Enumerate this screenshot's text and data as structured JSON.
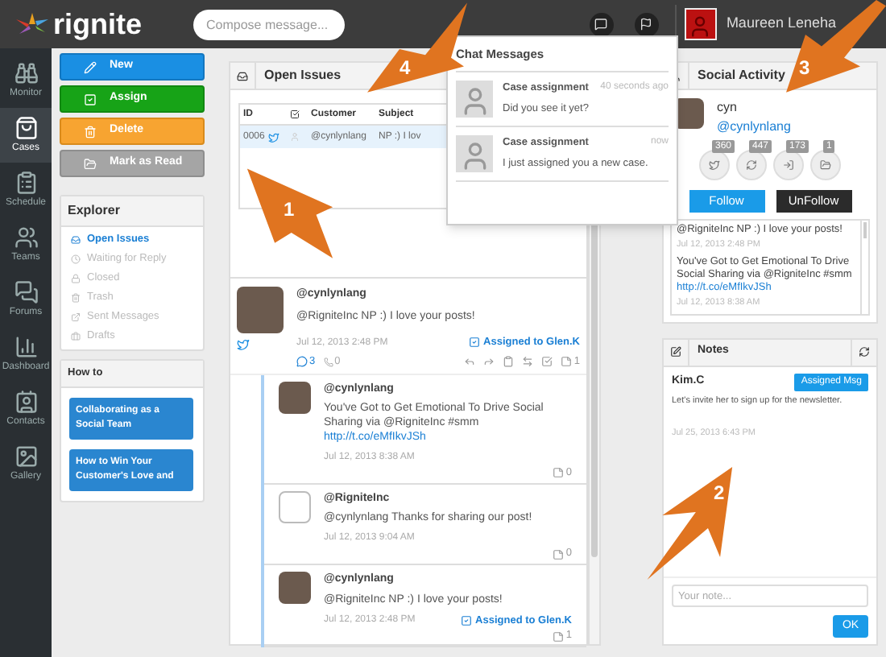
{
  "topbar": {
    "logo": "rignite",
    "compose_placeholder": "Compose message...",
    "user_name": "Maureen Leneha"
  },
  "nav": [
    {
      "label": "Monitor",
      "selected": false
    },
    {
      "label": "Cases",
      "selected": true
    },
    {
      "label": "Schedule",
      "selected": false
    },
    {
      "label": "Teams",
      "selected": false
    },
    {
      "label": "Forums",
      "selected": false
    },
    {
      "label": "Dashboard",
      "selected": false
    },
    {
      "label": "Contacts",
      "selected": false
    },
    {
      "label": "Gallery",
      "selected": false
    }
  ],
  "actions": [
    {
      "label": "New",
      "kind": "new"
    },
    {
      "label": "Assign",
      "kind": "assign"
    },
    {
      "label": "Delete",
      "kind": "delete"
    },
    {
      "label": "Mark as Read",
      "kind": "read"
    }
  ],
  "explorer": {
    "title": "Explorer",
    "items": [
      {
        "label": "Open Issues",
        "selected": true
      },
      {
        "label": "Waiting for Reply",
        "selected": false
      },
      {
        "label": "Closed",
        "selected": false
      },
      {
        "label": "Trash",
        "selected": false
      },
      {
        "label": "Sent Messages",
        "selected": false
      },
      {
        "label": "Drafts",
        "selected": false
      }
    ]
  },
  "howto": {
    "title": "How to",
    "links": [
      "Collaborating as a Social Team",
      "How to Win Your Customer's Love and"
    ]
  },
  "open_issues": {
    "title": "Open Issues",
    "columns": [
      "ID",
      "Customer",
      "Subject"
    ],
    "rows": [
      {
        "id": "0006",
        "customer": "@cynlynlang",
        "subject": "NP :) I lov",
        "selected": true
      }
    ]
  },
  "feed": {
    "post": {
      "handle": "@cynlynlang",
      "text": "@RigniteInc NP :) I love your posts!",
      "date": "Jul 12, 2013 2:48 PM",
      "assigned": "Assigned to Glen.K",
      "comments": "3",
      "calls": "0",
      "notes": "1"
    },
    "replies": [
      {
        "handle": "@cynlynlang",
        "kind": "photo",
        "text": "You've Got to Get Emotional To Drive Social Sharing via @RigniteInc #smm",
        "link": "http://t.co/eMfIkvJSh",
        "date": "Jul 12, 2013 8:38 AM",
        "notes": "0"
      },
      {
        "handle": "@RigniteInc",
        "kind": "blank",
        "text": "@cynlynlang Thanks for sharing our post!",
        "date": "Jul 12, 2013 9:04 AM",
        "notes": "0"
      },
      {
        "handle": "@cynlynlang",
        "kind": "photo",
        "text": "@RigniteInc NP :) I love your posts!",
        "date": "Jul 12, 2013 2:48 PM",
        "assigned": "Assigned to Glen.K",
        "notes": "1"
      }
    ]
  },
  "chat": {
    "title": "Chat Messages",
    "messages": [
      {
        "title": "Case assignment",
        "time": "40 seconds ago",
        "text": "Did you see it yet?"
      },
      {
        "title": "Case assignment",
        "time": "now",
        "text": "I just assigned you a new case."
      }
    ]
  },
  "social": {
    "title": "Social Activity",
    "name": "cyn",
    "handle": "@cynlynlang",
    "stats": [
      "360",
      "447",
      "173",
      "1"
    ],
    "follow": "Follow",
    "unfollow": "UnFollow",
    "feed": [
      {
        "text": "@RigniteInc NP :) I love your posts!",
        "date": "Jul 12, 2013 2:48 PM"
      },
      {
        "text": "You've Got to Get Emotional To Drive Social Sharing via @RigniteInc #smm",
        "link": "http://t.co/eMfIkvJSh",
        "date": "Jul 12, 2013 8:38 AM"
      }
    ]
  },
  "notes": {
    "title": "Notes",
    "items": [
      {
        "author": "Kim.C",
        "badge": "Assigned Msg",
        "text": "Let's invite her to sign up for the newsletter.",
        "date": "Jul 25, 2013 6:43 PM"
      }
    ],
    "placeholder": "Your note...",
    "ok": "OK"
  },
  "callouts": [
    {
      "number": "1"
    },
    {
      "number": "2"
    },
    {
      "number": "3"
    },
    {
      "number": "4"
    }
  ]
}
